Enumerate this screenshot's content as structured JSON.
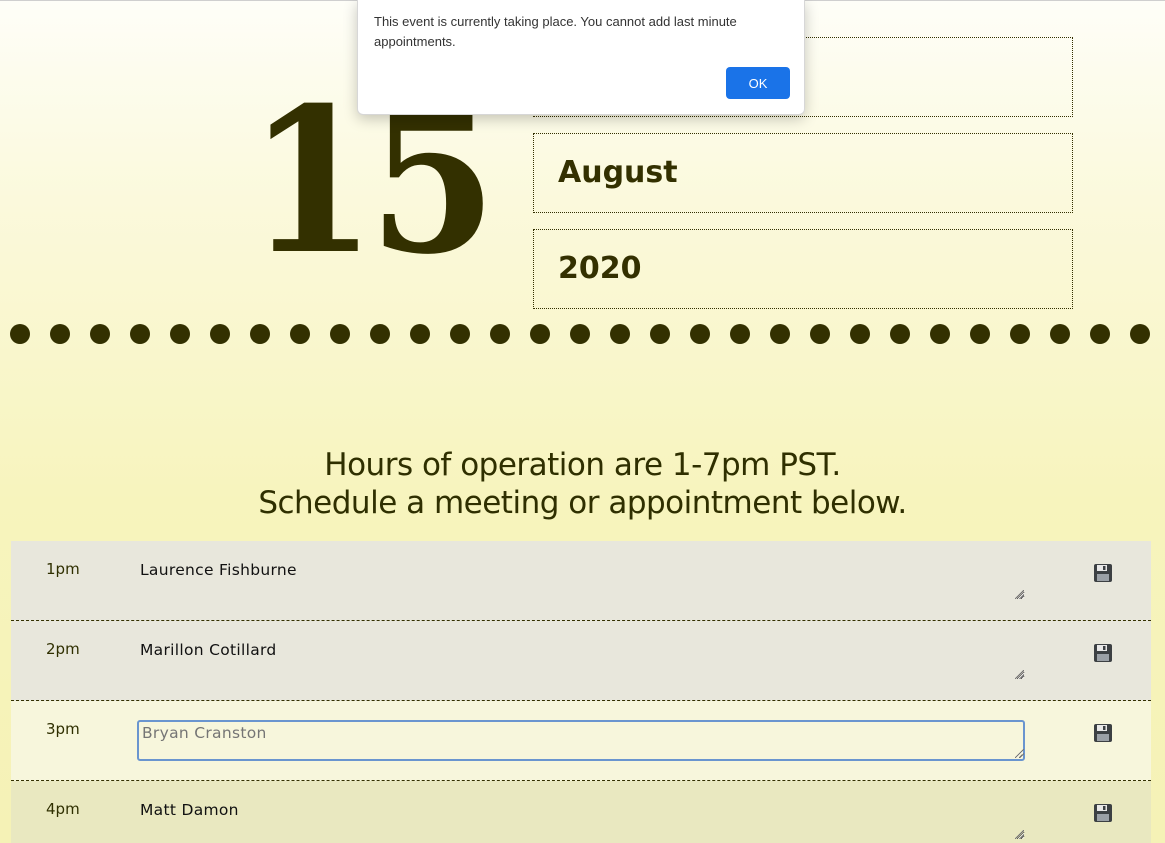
{
  "header": {
    "day": "15",
    "weekday": "",
    "month": "August",
    "year": "2020"
  },
  "info": {
    "line1": "Hours of operation are 1-7pm PST.",
    "line2": "Schedule a meeting or appointment below."
  },
  "schedule": [
    {
      "hour": "1pm",
      "note": "Laurence Fishburne",
      "state": "past"
    },
    {
      "hour": "2pm",
      "note": "Marillon Cotillard",
      "state": "past"
    },
    {
      "hour": "3pm",
      "note": "",
      "placeholder": "Bryan Cranston",
      "state": "present"
    },
    {
      "hour": "4pm",
      "note": "Matt Damon",
      "state": "future"
    }
  ],
  "dialog": {
    "message": "This event is currently taking place. You cannot add last minute appointments.",
    "ok_label": "OK"
  },
  "colors": {
    "accent": "#333000",
    "past_row": "#e8e7dc",
    "present_row": "#f7f6dc",
    "future_row": "#e9e8c0",
    "dialog_button": "#1a73e8"
  },
  "icons": {
    "save": "floppy-disk-icon"
  }
}
